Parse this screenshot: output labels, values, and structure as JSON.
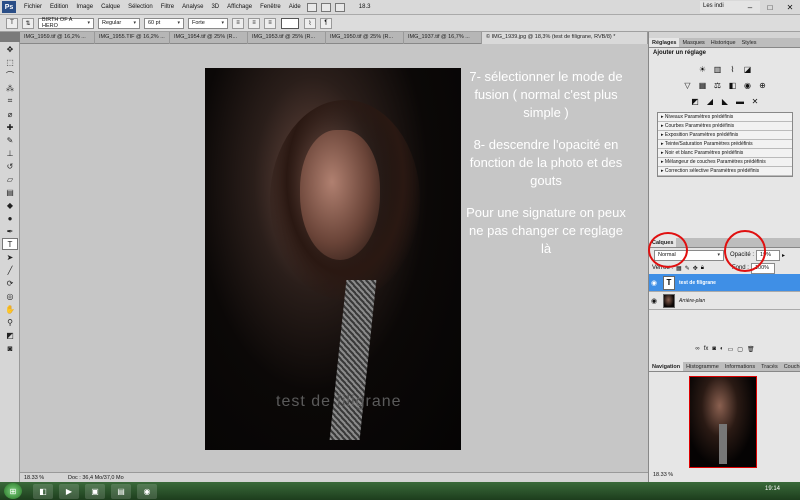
{
  "app": {
    "logo": "Ps"
  },
  "menu": [
    "Fichier",
    "Edition",
    "Image",
    "Calque",
    "Sélection",
    "Filtre",
    "Analyse",
    "3D",
    "Affichage",
    "Fenêtre",
    "Aide"
  ],
  "menubar_zoom": "18.3",
  "workspace": "Les indi",
  "options": {
    "font_family": "BIRTH OF A HERO",
    "font_style": "Regular",
    "font_size": "60 pt",
    "antialias": "Forte"
  },
  "doc_tabs": [
    "IMG_1959.tif @ 16,2% ...",
    "IMG_1955.TIF @ 16,2% ...",
    "IMG_1954.tif @ 25% (R...",
    "IMG_1953.tif @ 25% (R...",
    "IMG_1950.tif @ 25% (R...",
    "IMG_1937.tif @ 16,7% ...",
    "© IMG_1939.jpg @ 18,3% (test de filigrane, RVB/8) *"
  ],
  "watermark_text": "test de filigrane",
  "instructions": [
    "7- sélectionner le mode de fusion ( normal c'est plus simple )",
    "8- descendre l'opacité en fonction de la photo et des gouts",
    "Pour une signature on peux ne pas changer ce reglage là"
  ],
  "status": {
    "zoom": "18.33 %",
    "doc": "Doc : 36,4 Mo/37,0 Mo"
  },
  "adjustments": {
    "tabs": [
      "Réglages",
      "Masques",
      "Historique",
      "Styles"
    ],
    "heading": "Ajouter un réglage",
    "presets": [
      "Niveaux Paramètres prédéfinis",
      "Courbes Paramètres prédéfinis",
      "Exposition Paramètres prédéfinis",
      "Teinte/Saturation Paramètres prédéfinis",
      "Noir et blanc Paramètres prédéfinis",
      "Mélangeur de couches Paramètres prédéfinis",
      "Correction sélective Paramètres prédéfinis"
    ]
  },
  "layers": {
    "tab": "Calques",
    "blend_mode": "Normal",
    "opacity_label": "Opacité :",
    "opacity_value": "19%",
    "lock_label": "Verrou :",
    "fill_label": "Fond :",
    "fill_value": "100%",
    "items": [
      {
        "name": "test de filigrane",
        "thumb": "T"
      },
      {
        "name": "Arrière-plan",
        "thumb": ""
      }
    ]
  },
  "navigator": {
    "tabs": [
      "Navigation",
      "Histogramme",
      "Informations",
      "Tracés",
      "Couches"
    ],
    "zoom": "18.33 %"
  },
  "taskbar": {
    "clock": "19:14"
  },
  "colors": {
    "accent": "#3f8fe6",
    "annotation": "#e01010"
  }
}
